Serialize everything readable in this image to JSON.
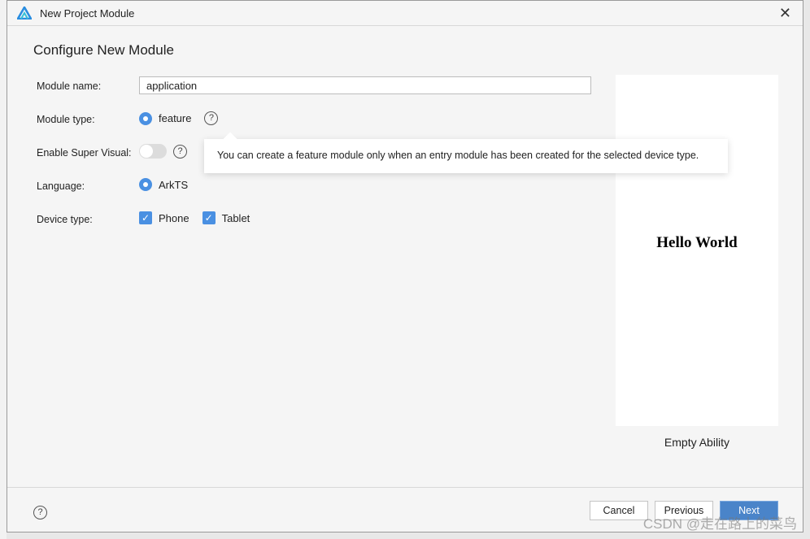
{
  "window": {
    "title": "New Project Module",
    "logo": "harmonyos-deveco-logo",
    "close_icon": "close-icon"
  },
  "heading": "Configure New Module",
  "form": {
    "module_name_label": "Module name:",
    "module_name_value": "application",
    "module_type_label": "Module type:",
    "module_type_option": "feature",
    "super_visual_label": "Enable Super Visual:",
    "super_visual_on": false,
    "language_label": "Language:",
    "language_option": "ArkTS",
    "device_type_label": "Device type:",
    "devices": [
      {
        "label": "Phone",
        "checked": true
      },
      {
        "label": "Tablet",
        "checked": true
      }
    ]
  },
  "tooltip": "You can create a feature module only when an entry module has been created for the selected device type.",
  "preview": {
    "text": "Hello World",
    "caption": "Empty Ability"
  },
  "footer": {
    "cancel": "Cancel",
    "previous": "Previous",
    "next": "Next"
  },
  "colors": {
    "accent": "#4a90e2",
    "primary_button": "#4a84c9"
  },
  "watermark": "CSDN @走在路上的菜鸟"
}
